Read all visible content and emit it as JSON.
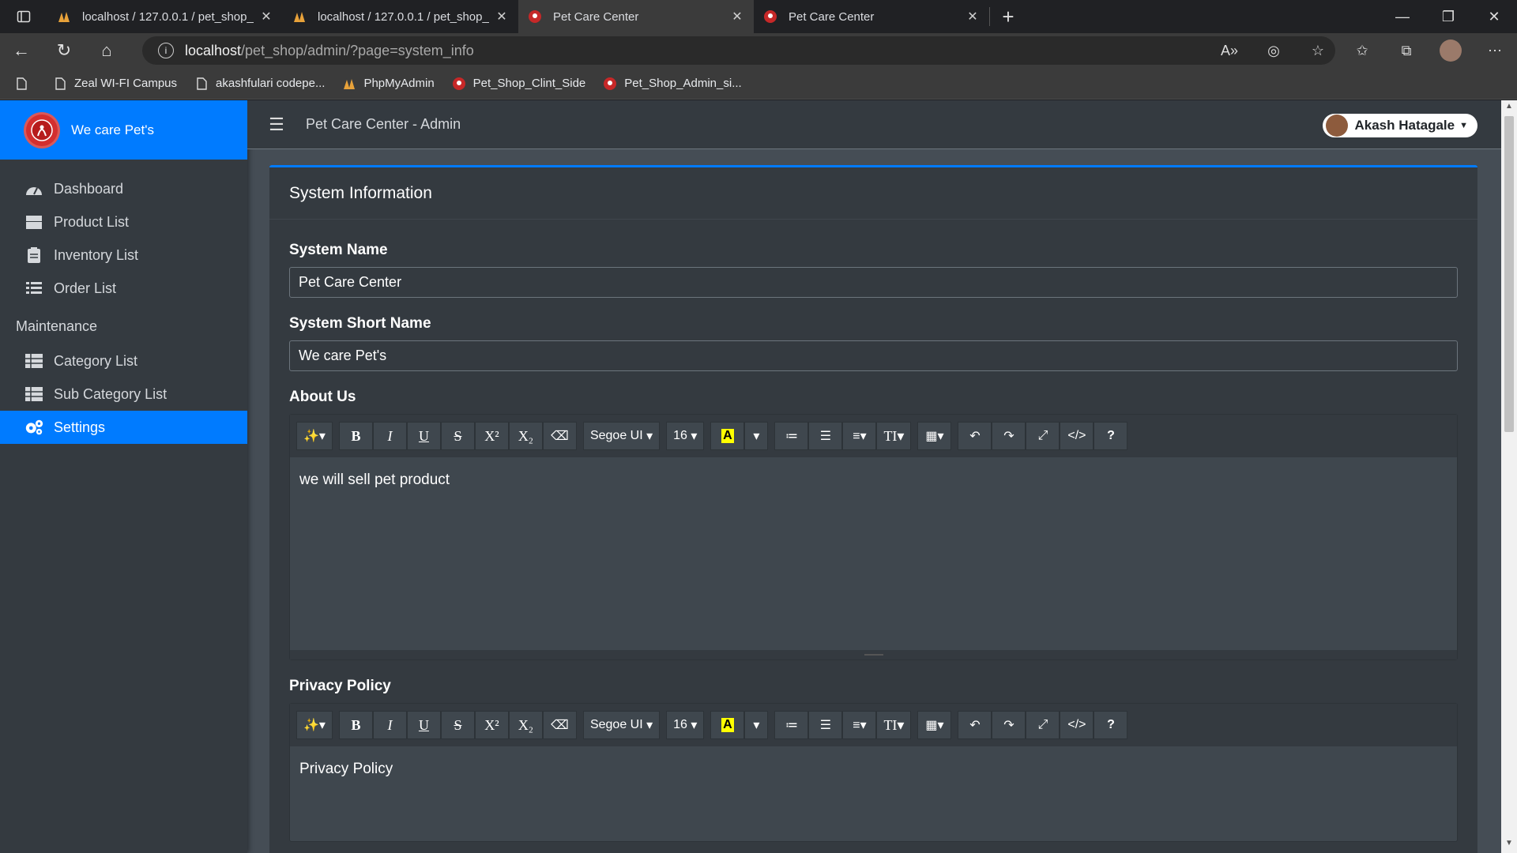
{
  "browser": {
    "tabs": [
      {
        "title": "localhost / 127.0.0.1 / pet_shop_",
        "active": false,
        "favicon": "phpmyadmin-icon"
      },
      {
        "title": "localhost / 127.0.0.1 / pet_shop_",
        "active": false,
        "favicon": "phpmyadmin-icon"
      },
      {
        "title": "Pet Care Center",
        "active": true,
        "favicon": "pet-logo-icon"
      },
      {
        "title": "Pet Care Center",
        "active": false,
        "favicon": "pet-logo-icon"
      }
    ],
    "url_host": "localhost",
    "url_path": "/pet_shop/admin/?page=system_info",
    "bookmarks": [
      {
        "label": "Zeal WI-FI Campus",
        "icon": "page-icon"
      },
      {
        "label": "akashfulari codepe...",
        "icon": "page-icon"
      },
      {
        "label": "PhpMyAdmin",
        "icon": "phpmyadmin-icon"
      },
      {
        "label": "Pet_Shop_Clint_Side",
        "icon": "pet-logo-icon"
      },
      {
        "label": "Pet_Shop_Admin_si...",
        "icon": "pet-logo-icon"
      }
    ]
  },
  "sidebar": {
    "brand": "We care Pet's",
    "items": [
      {
        "label": "Dashboard",
        "icon": "dashboard-icon"
      },
      {
        "label": "Product List",
        "icon": "box-icon"
      },
      {
        "label": "Inventory List",
        "icon": "clipboard-icon"
      },
      {
        "label": "Order List",
        "icon": "list-icon"
      }
    ],
    "section_header": "Maintenance",
    "maintenance_items": [
      {
        "label": "Category List",
        "icon": "table-icon"
      },
      {
        "label": "Sub Category List",
        "icon": "table-icon"
      },
      {
        "label": "Settings",
        "icon": "cogs-icon",
        "active": true
      }
    ]
  },
  "topnav": {
    "title": "Pet Care Center - Admin",
    "user": "Akash Hatagale"
  },
  "card": {
    "title": "System Information",
    "system_name_label": "System Name",
    "system_name_value": "Pet Care Center",
    "short_name_label": "System Short Name",
    "short_name_value": "We care Pet's",
    "about_label": "About Us",
    "about_content": "we will sell pet product",
    "privacy_label": "Privacy Policy",
    "privacy_content": "Privacy Policy",
    "toolbar": {
      "font_name": "Segoe UI",
      "font_size": "16"
    }
  },
  "colors": {
    "accent": "#007bff",
    "sidebar_bg": "#343a40",
    "page_bg": "#454d55"
  }
}
